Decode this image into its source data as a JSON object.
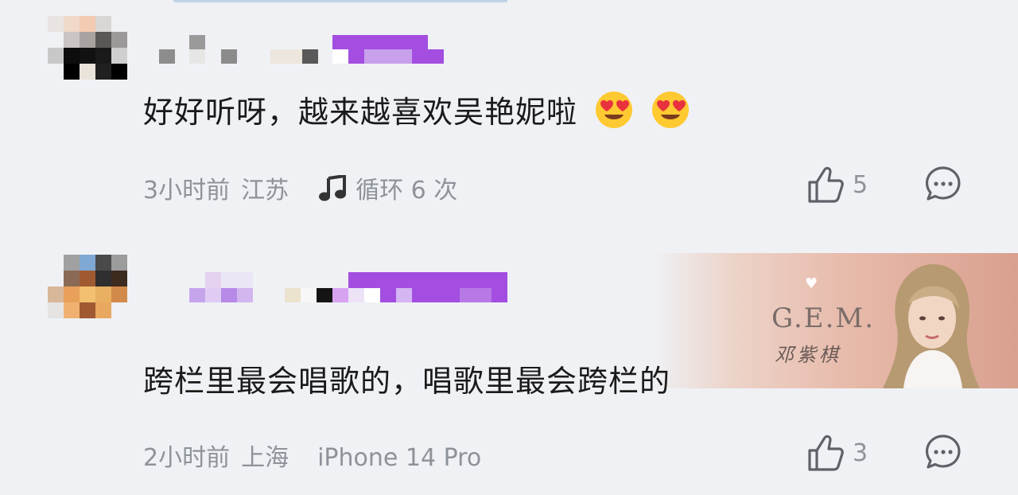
{
  "comments": [
    {
      "text": "好好听呀，越来越喜欢吴艳妮啦",
      "emojis": [
        "heart-eyes-emoji",
        "heart-eyes-emoji"
      ],
      "time": "3小时前",
      "location": "江苏",
      "extra_icon": "music-note-icon",
      "extra": "循环 6 次",
      "likes": "5"
    },
    {
      "text": "跨栏里最会唱歌的，唱歌里最会跨栏的",
      "time": "2小时前",
      "location": "上海",
      "extra": "iPhone 14 Pro",
      "likes": "3",
      "banner": {
        "logo": "G.E.M.",
        "artist_cn": "邓紫棋"
      }
    }
  ],
  "colors": {
    "background": "#eff1f5",
    "text": "#1a1a1a",
    "meta": "#8e9299",
    "username_mosaic": "#a34ee0"
  },
  "icons": [
    "thumbs-up-icon",
    "comment-bubble-icon",
    "music-note-icon"
  ]
}
